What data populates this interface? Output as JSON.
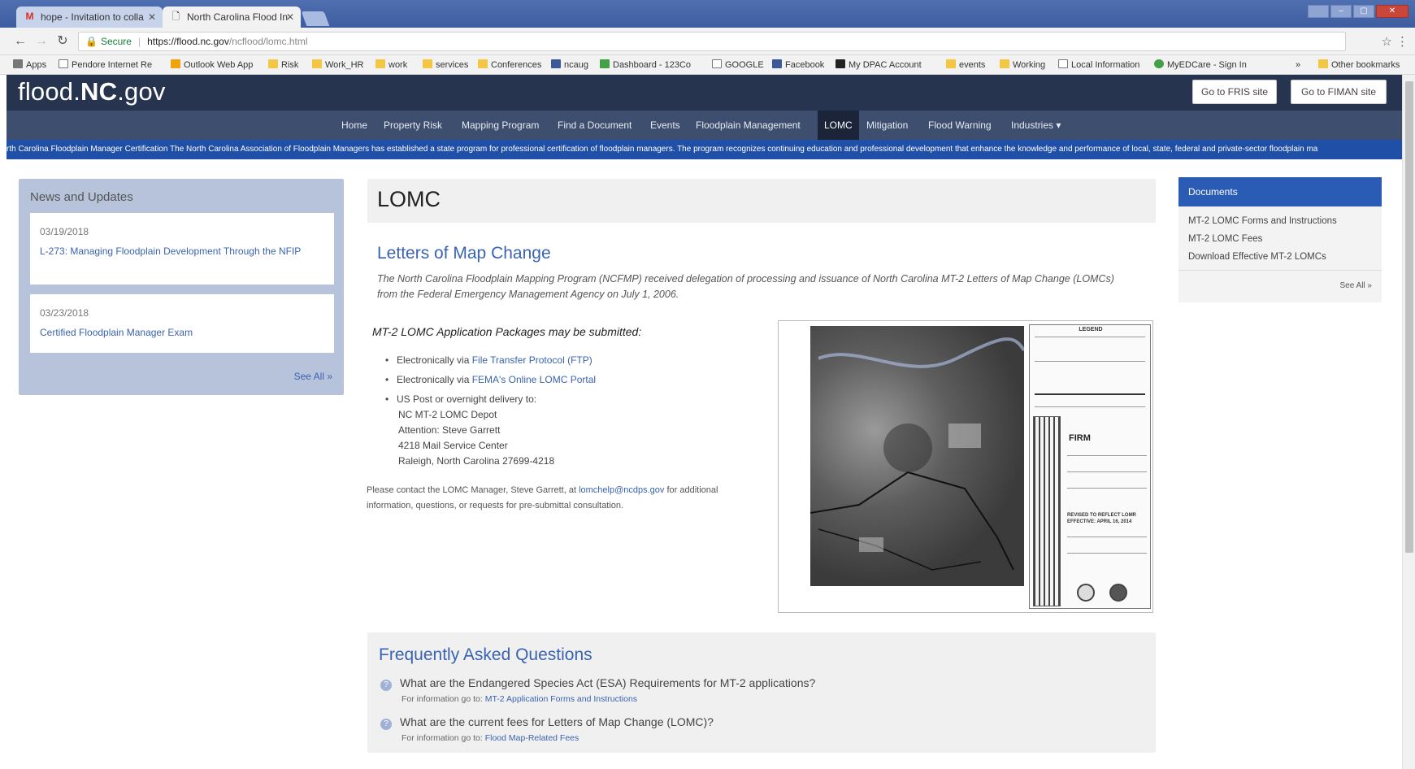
{
  "browser": {
    "tabs": [
      {
        "label": "hope - Invitation to colla",
        "icon": "gmail-icon"
      },
      {
        "label": "North Carolina Flood In",
        "icon": "page-icon"
      }
    ],
    "address": {
      "secure_label": "Secure",
      "url_host": "https://flood.nc.gov",
      "url_path": "/ncflood/lomc.html"
    },
    "bookmarks": [
      {
        "label": "Apps",
        "icon": "apps-grid-icon"
      },
      {
        "label": "Pendore Internet Re",
        "icon": "page-icon"
      },
      {
        "label": "Outlook Web App",
        "icon": "outlook-icon"
      },
      {
        "label": "Risk",
        "icon": "folder-icon"
      },
      {
        "label": "Work_HR",
        "icon": "folder-icon"
      },
      {
        "label": "work",
        "icon": "folder-icon"
      },
      {
        "label": "services",
        "icon": "folder-icon"
      },
      {
        "label": "Conferences",
        "icon": "folder-icon"
      },
      {
        "label": "ncaug",
        "icon": "bookmark-icon"
      },
      {
        "label": "Dashboard - 123Co",
        "icon": "dashboard-icon"
      },
      {
        "label": "GOOGLE",
        "icon": "google-icon"
      },
      {
        "label": "Facebook",
        "icon": "facebook-icon"
      },
      {
        "label": "My DPAC Account",
        "icon": "dpac-icon"
      },
      {
        "label": "events",
        "icon": "folder-icon"
      },
      {
        "label": "Working",
        "icon": "folder-icon"
      },
      {
        "label": "Local Information",
        "icon": "page-icon"
      },
      {
        "label": "MyEDCare - Sign In",
        "icon": "edcare-icon"
      },
      {
        "label": "Other bookmarks",
        "icon": "folder-icon"
      }
    ],
    "overflow_label": "»"
  },
  "site": {
    "logo_prefix": "flood.",
    "logo_bold": "NC",
    "logo_suffix": ".gov",
    "header_buttons": {
      "fris": "Go to FRIS site",
      "fiman": "Go to FIMAN site"
    },
    "nav": [
      {
        "label": "Home",
        "active": false
      },
      {
        "label": "Property Risk",
        "active": false
      },
      {
        "label": "Mapping Program",
        "active": false
      },
      {
        "label": "Find a Document",
        "active": false
      },
      {
        "label": "Events",
        "active": false
      },
      {
        "label": "Floodplain Management",
        "active": false
      },
      {
        "label": "LOMC",
        "active": true
      },
      {
        "label": "Mitigation",
        "active": false
      },
      {
        "label": "Flood Warning",
        "active": false
      },
      {
        "label": "Industries ▾",
        "active": false
      }
    ],
    "ticker": "rth Carolina Floodplain Manager Certification The North Carolina Association of Floodplain Managers has established a state program for professional certification of floodplain managers. The program recognizes continuing education and professional development that enhance the knowledge and performance of local, state, federal and private-sector floodplain ma"
  },
  "news": {
    "title": "News and Updates",
    "items": [
      {
        "date": "03/19/2018",
        "text": "L-273: Managing Floodplain Development Through the NFIP"
      },
      {
        "date": "03/23/2018",
        "text": "Certified Floodplain Manager Exam"
      }
    ],
    "see_all": "See All »"
  },
  "main": {
    "page_title": "LOMC",
    "section_heading": "Letters of Map Change",
    "intro": "The North Carolina Floodplain Mapping Program (NCFMP) received delegation of processing and issuance of North Carolina MT-2 Letters of Map Change (LOMCs) from the Federal Emergency Management Agency on July 1, 2006.",
    "packages_heading": "MT-2 LOMC Application Packages may be submitted:",
    "methods": {
      "ftp_prefix": "Electronically via ",
      "ftp_link": "File Transfer Protocol (FTP)",
      "portal_prefix": "Electronically via ",
      "portal_link": "FEMA's Online LOMC Portal",
      "post_text": "US Post or overnight delivery to:",
      "address": [
        "NC MT-2 LOMC Depot",
        "Attention: Steve Garrett",
        "4218 Mail Service Center",
        "Raleigh, North Carolina 27699-4218"
      ]
    },
    "contact": {
      "prefix": "Please contact the LOMC Manager, Steve Garrett, at ",
      "email": "lomchelp@ncdps.gov",
      "suffix": " for additional information, questions, or requests for pre-submittal consultation."
    },
    "firm_image": {
      "legend_title": "LEGEND",
      "firm_label": "FIRM",
      "revised_text": "REVISED TO REFLECT LOMR EFFECTIVE: APRIL 16, 2014"
    }
  },
  "faq": {
    "title": "Frequently Asked Questions",
    "items": [
      {
        "question": "What are the Endangered Species Act (ESA) Requirements for MT-2 applications?",
        "answer_prefix": "For information go to: ",
        "answer_link": "MT-2 Application Forms and Instructions"
      },
      {
        "question": "What are the current fees for Letters of Map Change (LOMC)?",
        "answer_prefix": "For information go to: ",
        "answer_link": "Flood Map-Related Fees"
      }
    ]
  },
  "documents": {
    "header": "Documents",
    "links": [
      "MT-2 LOMC Forms and Instructions",
      "MT-2 LOMC Fees",
      "Download Effective MT-2 LOMCs"
    ],
    "see_all": "See All »"
  },
  "colors": {
    "header_bg": "#26344f",
    "nav_bg": "#3e4e6e",
    "ticker_bg": "#1f4fa6",
    "link": "#3a63b0",
    "docs_header": "#2b5cb5"
  }
}
